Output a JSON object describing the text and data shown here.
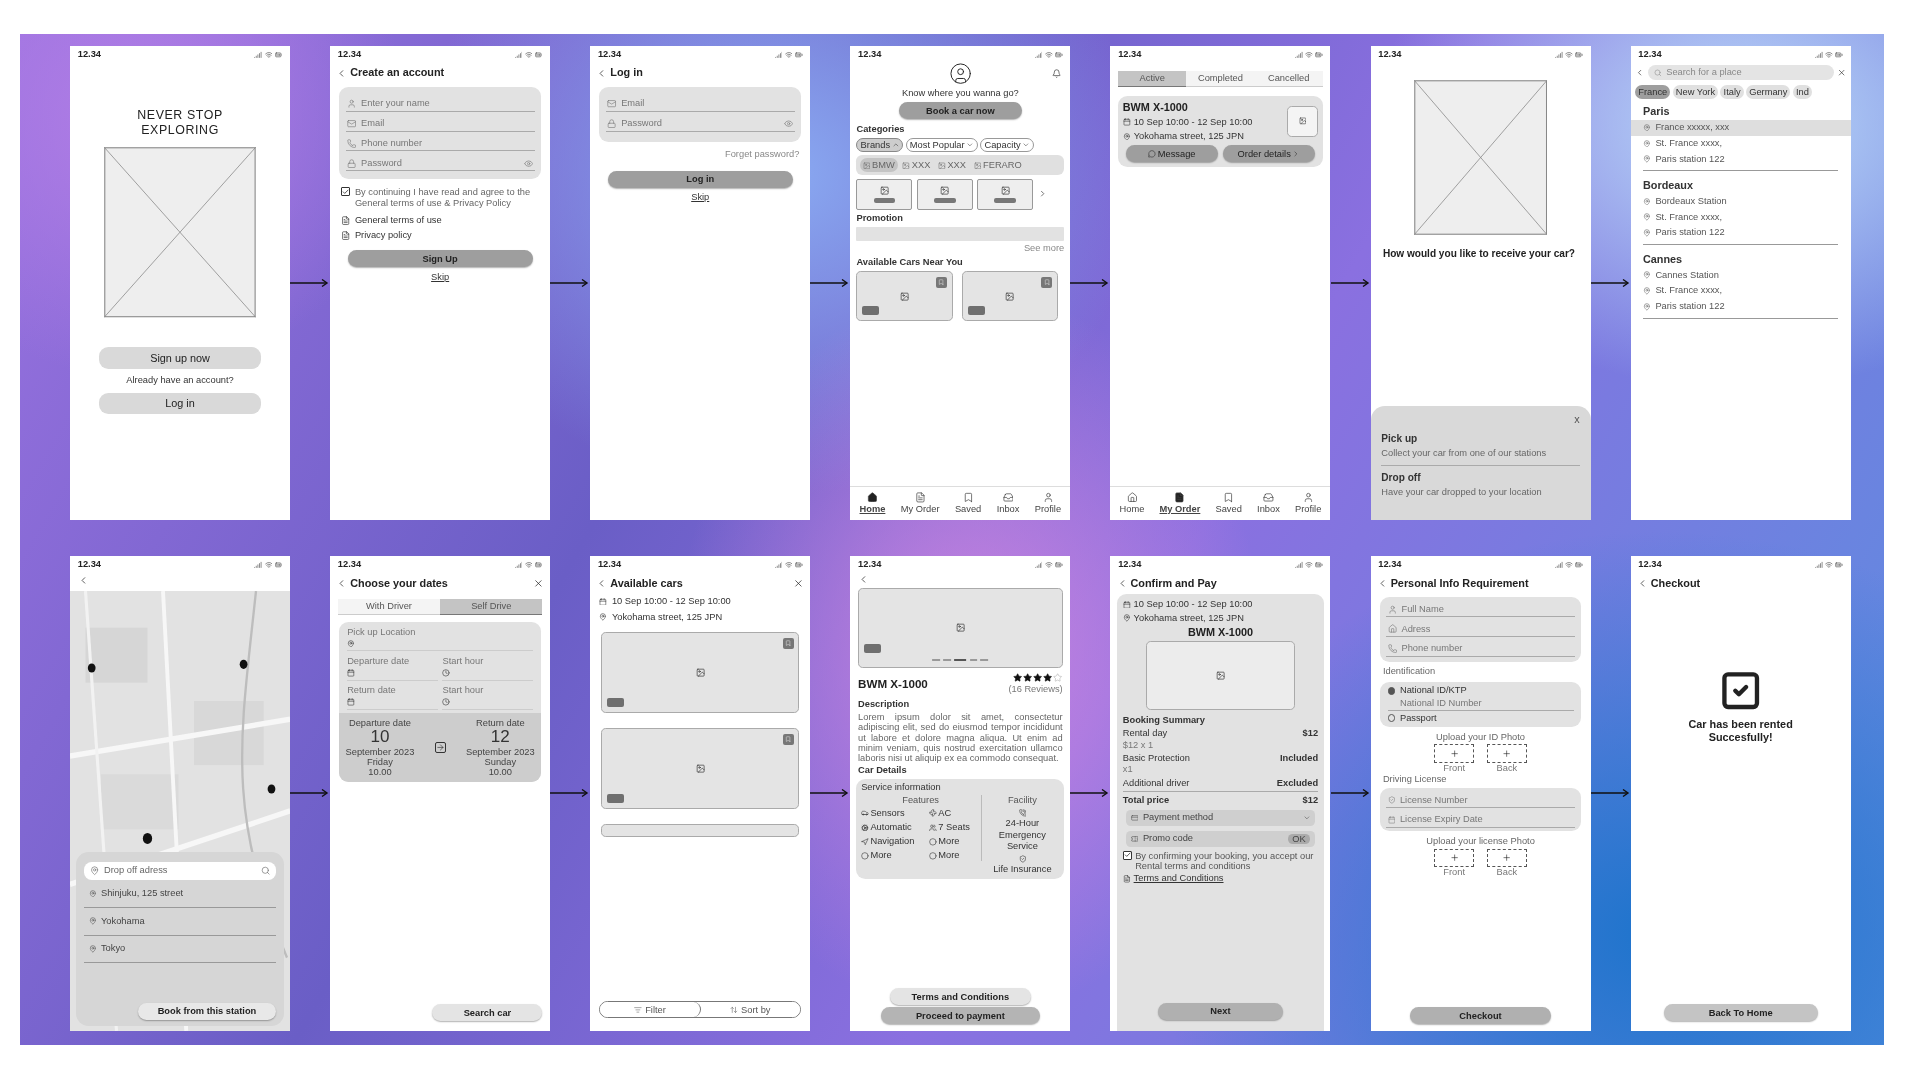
{
  "screens": [
    {
      "kind": "welcome",
      "time": "12.34",
      "title": "NEVER STOP EXPLORING",
      "signup": "Sign up now",
      "prompt": "Already have an account?",
      "login": "Log in"
    },
    {
      "kind": "signup",
      "time": "12.34",
      "title": "Create an account",
      "fields": [
        "Enter your name",
        "Email",
        "Phone number",
        "Password"
      ],
      "consent": {
        "text": "By continuing I have read and agree to the General terms of use & Privacy Policy",
        "checked": true
      },
      "links": [
        "General terms of use",
        "Privacy policy"
      ],
      "button": "Sign Up",
      "skip": "Skip"
    },
    {
      "kind": "login",
      "time": "12.34",
      "title": "Log in",
      "fields": [
        "Email",
        "Password"
      ],
      "forgot": "Forget password?",
      "button": "Log in",
      "skip": "Skip"
    },
    {
      "kind": "home",
      "time": "12.34",
      "greeting": "Know where you wanna go?",
      "cta": "Book a car now",
      "categories_label": "Categories",
      "filters": [
        {
          "label": "Brands",
          "selected": true
        },
        {
          "label": "Most Popular",
          "selected": false
        },
        {
          "label": "Capacity",
          "selected": false
        }
      ],
      "brands": [
        {
          "label": "BMW",
          "selected": true
        },
        {
          "label": "XXX",
          "selected": false
        },
        {
          "label": "XXX",
          "selected": false
        },
        {
          "label": "FERARO",
          "selected": false
        }
      ],
      "promotion_label": "Promotion",
      "see_more": "See more",
      "nearby_label": "Available Cars Near You",
      "nav": [
        {
          "label": "Home",
          "selected": true
        },
        {
          "label": "My Order",
          "selected": false
        },
        {
          "label": "Saved",
          "selected": false
        },
        {
          "label": "Inbox",
          "selected": false
        },
        {
          "label": "Profile",
          "selected": false
        }
      ]
    },
    {
      "kind": "orders",
      "time": "12.34",
      "tabs": [
        {
          "label": "Active",
          "selected": true
        },
        {
          "label": "Completed",
          "selected": false
        },
        {
          "label": "Cancelled",
          "selected": false
        }
      ],
      "order": {
        "title": "BWM X-1000",
        "dates": "10 Sep 10:00 - 12 Sep 10:00",
        "address": "Yokohama street, 125 JPN",
        "actions": [
          "Message",
          "Order details"
        ]
      },
      "nav": [
        {
          "label": "Home",
          "selected": false
        },
        {
          "label": "My Order",
          "selected": true
        },
        {
          "label": "Saved",
          "selected": false
        },
        {
          "label": "Inbox",
          "selected": false
        },
        {
          "label": "Profile",
          "selected": false
        }
      ]
    },
    {
      "kind": "receive",
      "time": "12.34",
      "question": "How would you like to receive your car?",
      "close": "x",
      "options": [
        {
          "title": "Pick up",
          "desc": "Collect your car from one of our stations"
        },
        {
          "title": "Drop off",
          "desc": "Have your car dropped to your location"
        }
      ]
    },
    {
      "kind": "places",
      "time": "12.34",
      "search_placeholder": "Search for a place",
      "countries": [
        {
          "label": "France",
          "selected": true
        },
        {
          "label": "New York",
          "selected": false
        },
        {
          "label": "Italy",
          "selected": false
        },
        {
          "label": "Germany",
          "selected": false
        },
        {
          "label": "Ind",
          "selected": false
        }
      ],
      "groups": [
        {
          "city": "Paris",
          "places": [
            {
              "name": "France xxxxx, xxx",
              "selected": true
            },
            {
              "name": "St. France xxxx,",
              "selected": false
            },
            {
              "name": "Paris station 122",
              "selected": false
            }
          ]
        },
        {
          "city": "Bordeaux",
          "places": [
            {
              "name": "Bordeaux Station",
              "selected": false
            },
            {
              "name": "St. France xxxx,",
              "selected": false
            },
            {
              "name": "Paris station 122",
              "selected": false
            }
          ]
        },
        {
          "city": "Cannes",
          "places": [
            {
              "name": "Cannes Station",
              "selected": false
            },
            {
              "name": "St. France xxxx,",
              "selected": false
            },
            {
              "name": "Paris station 122",
              "selected": false
            }
          ]
        }
      ]
    },
    {
      "kind": "map",
      "time": "12.34",
      "search_placeholder": "Drop off adress",
      "places": [
        "Shinjuku, 125 street",
        "Yokohama",
        "Tokyo"
      ],
      "button": "Book from this station"
    },
    {
      "kind": "dates",
      "time": "12.34",
      "title": "Choose your dates",
      "tabs": [
        {
          "label": "With Driver",
          "selected": false
        },
        {
          "label": "Self Drive",
          "selected": true
        }
      ],
      "fields": [
        "Pick up Location",
        "Departure date",
        "Start hour",
        "Return date",
        "Start hour"
      ],
      "departure": {
        "label": "Departure date",
        "day": "10",
        "month": "September 2023",
        "weekday": "Friday",
        "time": "10.00"
      },
      "return": {
        "label": "Return date",
        "day": "12",
        "month": "September 2023",
        "weekday": "Sunday",
        "time": "10.00"
      },
      "button": "Search car"
    },
    {
      "kind": "cars",
      "time": "12.34",
      "title": "Available cars",
      "dates": "10 Sep 10:00 - 12 Sep 10:00",
      "address": "Yokohama street, 125 JPN",
      "tools": [
        "Filter",
        "Sort by"
      ]
    },
    {
      "kind": "detail",
      "time": "12.34",
      "title": "BWM X-1000",
      "stars": 4,
      "reviews": "(16 Reviews)",
      "description_label": "Description",
      "description": "Lorem ipsum dolor sit amet, consectetur adipiscing elit, sed do eiusmod tempor incididunt ut labore et dolore magna aliqua. Ut enim ad minim veniam, quis nostrud exercitation ullamco laboris nisi ut aliquip ex ea commodo consequat.",
      "details_label": "Car Details",
      "service_label": "Service information",
      "features_label": "Features",
      "features": [
        "Sensors",
        "AC",
        "Automatic",
        "7 Seats",
        "Navigation",
        "More",
        "More",
        "More"
      ],
      "facility_label": "Facility",
      "facilities": [
        "24-Hour Emergency Service",
        "Life Insurance"
      ],
      "terms": "Terms and Conditions",
      "button": "Proceed to payment"
    },
    {
      "kind": "confirm",
      "time": "12.34",
      "title": "Confirm and Pay",
      "dates": "10 Sep 10:00 - 12 Sep 10:00",
      "address": "Yokohama street, 125 JPN",
      "car": "BWM X-1000",
      "summary_label": "Booking Summary",
      "lines": [
        {
          "label": "Rental day",
          "sub": "$12 x 1",
          "value": "$12"
        },
        {
          "label": "Basic Protection",
          "sub": "x1",
          "value": "Included"
        },
        {
          "label": "Additional driver",
          "value": "Excluded"
        }
      ],
      "total": {
        "label": "Total price",
        "value": "$12"
      },
      "payment": "Payment method",
      "promo": "Promo code",
      "promo_button": "OK",
      "consent": {
        "text": "By confirming your booking, you accept our Rental terms and conditions",
        "checked": true
      },
      "terms": "Terms and Conditions",
      "button": "Next"
    },
    {
      "kind": "personal",
      "time": "12.34",
      "title": "Personal Info Requirement",
      "fields": [
        "Full Name",
        "Adress",
        "Phone number"
      ],
      "id_label": "Identification",
      "id_options": [
        {
          "label": "National ID/KTP",
          "selected": true
        },
        {
          "label": "Passport",
          "selected": false
        }
      ],
      "id_number": "National ID Number",
      "upload_id": "Upload your ID Photo",
      "id_slots": [
        "Front",
        "Back"
      ],
      "license_label": "Driving License",
      "license_fields": [
        "License Number",
        "License Expiry Date"
      ],
      "upload_license": "Upload your license Photo",
      "license_slots": [
        "Front",
        "Back"
      ],
      "button": "Checkout"
    },
    {
      "kind": "done",
      "time": "12.34",
      "title": "Checkout",
      "message": "Car has been rented Succesfully!",
      "button": "Back To Home"
    }
  ]
}
